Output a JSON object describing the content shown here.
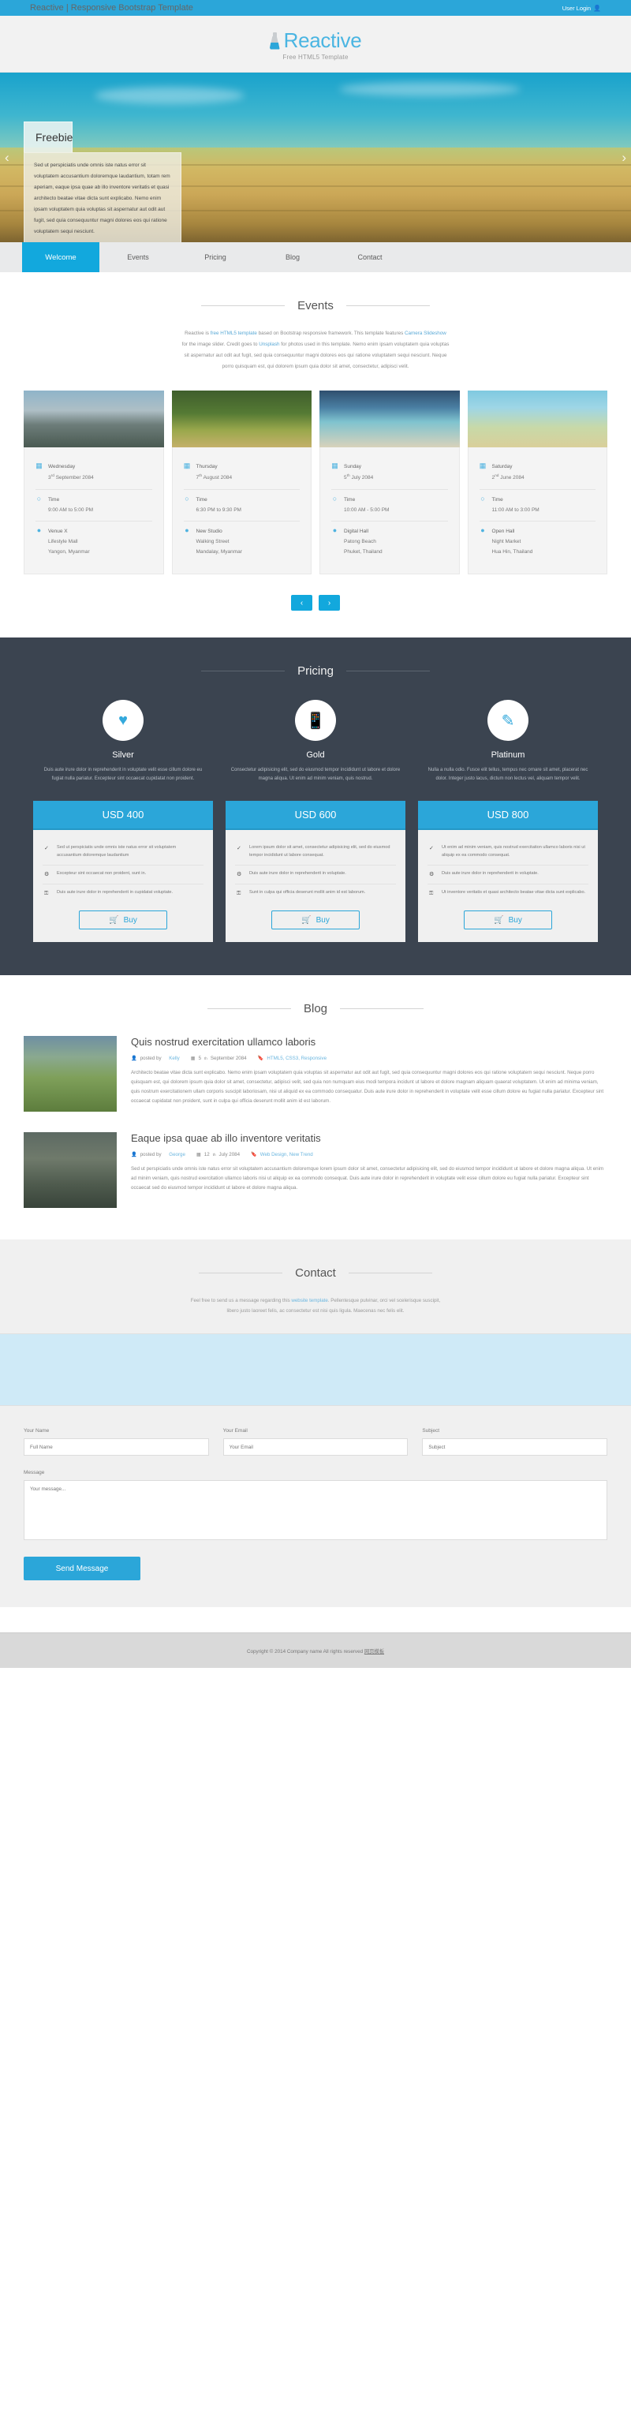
{
  "topbar": {
    "title": "Reactive | Responsive Bootstrap Template",
    "login_label": "User Login",
    "user_icon": "user-icon",
    "bg_color": "#2ba6d9"
  },
  "logo": {
    "name": "Reactive",
    "tagline": "Free HTML5 Template",
    "icon": "flask-icon",
    "accent_color": "#4ab5e2"
  },
  "hero": {
    "caption_title": "Freebie",
    "caption_body": "Sed ut perspiciatis unde omnis iste natus error sit voluptatem accusantium doloremque laudantium, totam rem aperiam, eaque ipsa quae ab illo inventore veritatis et quasi architecto beatae vitae dicta sunt explicabo. Nemo enim ipsam voluptatem quia voluptas sit aspernatur aut odit aut fugit, sed quia consequuntur magni dolores eos qui ratione voluptatem sequi nesciunt.",
    "prev_icon": "chevron-left-icon",
    "next_icon": "chevron-right-icon",
    "prev_glyph": "‹",
    "next_glyph": "›"
  },
  "nav": {
    "items": [
      {
        "label": "Welcome",
        "active": true
      },
      {
        "label": "Events",
        "active": false
      },
      {
        "label": "Pricing",
        "active": false
      },
      {
        "label": "Blog",
        "active": false
      },
      {
        "label": "Contact",
        "active": false
      }
    ],
    "active_color": "#12a8dd"
  },
  "events": {
    "heading": "Events",
    "intro_parts": [
      "Reactive is ",
      "free HTML5 template",
      " based on Bootstrap responsive framework. This template features ",
      "Camera Slideshow",
      " for the image slider. Credit goes to ",
      "Unsplash",
      " for photos used in this template. Nemo enim ipsam voluptatem quia voluptas sit aspernatur aut odit aut fugit, sed quia consequuntur magni dolores eos qui ratione voluptatem sequi nesciunt. Neque porro quisquam est, qui dolorem ipsum quia dolor sit amet, consectetur, adipisci velit."
    ],
    "cards": [
      {
        "image": "mountain-photo",
        "day": "Wednesday",
        "date": "3",
        "date_sup": "rd",
        "date_rest": " September 2084",
        "time_label": "Time",
        "time_value": "9:00 AM to 5:00 PM",
        "venue": "Venue X",
        "venue_line2": "Lifestyle Mall",
        "venue_line3": "Yangon, Myanmar"
      },
      {
        "image": "forest-path-photo",
        "day": "Thursday",
        "date": "7",
        "date_sup": "th",
        "date_rest": " August 2084",
        "time_label": "Time",
        "time_value": "6:30 PM to 9:30 PM",
        "venue": "New Studio",
        "venue_line2": "Walking Street",
        "venue_line3": "Mandalay, Myanmar"
      },
      {
        "image": "beach-photo",
        "day": "Sunday",
        "date": "5",
        "date_sup": "th",
        "date_rest": " July 2084",
        "time_label": "Time",
        "time_value": "10:00 AM - 5:00 PM",
        "venue": "Digital Hall",
        "venue_line2": "Patong Beach",
        "venue_line3": "Phuket, Thailand"
      },
      {
        "image": "van-palms-photo",
        "day": "Saturday",
        "date": "2",
        "date_sup": "nd",
        "date_rest": " June 2084",
        "time_label": "Time",
        "time_value": "11:00 AM to 3:00 PM",
        "venue": "Open Hall",
        "venue_line2": "Night Market",
        "venue_line3": "Hua Hin, Thailand"
      }
    ],
    "calendar_icon": "calendar-icon",
    "clock_icon": "clock-icon",
    "pin_icon": "map-pin-icon",
    "prev_glyph": "‹",
    "next_glyph": "›"
  },
  "pricing": {
    "heading": "Pricing",
    "bg_color": "#3b4450",
    "buy_label": "Buy",
    "cart_icon": "cart-icon",
    "plans": [
      {
        "icon": "heart-icon",
        "icon_glyph": "♥",
        "name": "Silver",
        "desc": "Duis aute irure dolor in reprehenderit in voluptate velit esse cillum dolore eu fugiat nulla pariatur. Excepteur sint occaecat cupidatat non proident.",
        "price": "USD 400",
        "features": [
          {
            "icon": "check-icon",
            "glyph": "✓",
            "text": "Sed ut perspiciatis unde omnis iste natus error sit voluptatem accusantium doloremque laudantium"
          },
          {
            "icon": "gear-icon",
            "glyph": "⚙",
            "text": "Excepteur sint occaecat non proident, sunt in."
          },
          {
            "icon": "lock-icon",
            "glyph": "⚿",
            "text": "Duis aute irure dolor in reprehenderit in cupidatat voluptate."
          }
        ]
      },
      {
        "icon": "mobile-icon",
        "icon_glyph": "☐",
        "name": "Gold",
        "desc": "Consectetur adipisicing elit, sed do eiusmod tempor incididunt ut labore et dolore magna aliqua. Ut enim ad minim veniam, quis nostrud.",
        "price": "USD 600",
        "features": [
          {
            "icon": "check-icon",
            "glyph": "✓",
            "text": "Lorem ipsum dolor sit amet, consectetur adipisicing elit, sed do eiusmod tempor incididunt ut labore consequat."
          },
          {
            "icon": "gear-icon",
            "glyph": "⚙",
            "text": "Duis aute irure dolor in reprehenderit in voluptate."
          },
          {
            "icon": "lock-icon",
            "glyph": "⚿",
            "text": "Sunt in culpa qui officia deserunt mollit anim id est laborum."
          }
        ]
      },
      {
        "icon": "pencil-icon",
        "icon_glyph": "✎",
        "name": "Platinum",
        "desc": "Nulla a nulla odio. Fusce elit tellus, tempus nec ornare sit amet, placerat nec dolor. Integer justo lacus, dictum non lectus vel, aliquam tempor velit.",
        "price": "USD 800",
        "features": [
          {
            "icon": "check-icon",
            "glyph": "✓",
            "text": "Ut enim ad minim veniam, quis nostrud exercitation ullamco laboris nisi ut aliquip ex ea commodo consequat."
          },
          {
            "icon": "gear-icon",
            "glyph": "⚙",
            "text": "Duis aute irure dolor in reprehenderit in voluptate."
          },
          {
            "icon": "lock-icon",
            "glyph": "⚿",
            "text": "Ut inventore veritatis et quasi architecto beatae vitae dicta sunt explicabo."
          }
        ]
      }
    ]
  },
  "blog": {
    "heading": "Blog",
    "posts": [
      {
        "thumb": "mountain-trail-photo",
        "title": "Quis nostrud exercitation ullamco laboris",
        "author_prefix": "posted by",
        "author": "Kelly",
        "date": "5",
        "date_sup": "th",
        "date_rest": " September 2084",
        "tags": "HTML5, CSS3, Responsive",
        "user_icon": "user-icon",
        "calendar_icon": "calendar-icon",
        "tag_icon": "bookmark-icon",
        "body": "Architecto beatae vitae dicta sunt explicabo. Nemo enim ipsam voluptatem quia voluptas sit aspernatur aut odit aut fugit, sed quia consequuntur magni dolores eos qui ratione voluptatem sequi nesciunt. Neque porro quisquam est, qui dolorem ipsum quia dolor sit amet, consectetur, adipisci velit, sed quia non numquam eius modi tempora incidunt ut labore et dolore magnam aliquam quaerat voluptatem. Ut enim ad minima veniam, quis nostrum exercitationem ullam corporis suscipit laboriosam, nisi ut aliquid ex ea commodo consequatur. Duis aute irure dolor in reprehenderit in voluptate velit esse cillum dolore eu fugiat nulla pariatur. Excepteur sint occaecat cupidatat non proident, sunt in culpa qui officia deserunt mollit anim id est laborum."
      },
      {
        "thumb": "rocks-photo",
        "title": "Eaque ipsa quae ab illo inventore veritatis",
        "author_prefix": "posted by",
        "author": "George",
        "date": "12",
        "date_sup": "th",
        "date_rest": " July 2084",
        "tags": "Web Design, New Trend",
        "user_icon": "user-icon",
        "calendar_icon": "calendar-icon",
        "tag_icon": "bookmark-icon",
        "body": "Sed ut perspiciatis unde omnis iste natus error sit voluptatem accusantium doloremque lorem ipsum dolor sit amet, consectetur adipisicing elit, sed do eiusmod tempor incididunt ut labore et dolore magna aliqua. Ut enim ad minim veniam, quis nostrud exercitation ullamco laboris nisi ut aliquip ex ea commodo consequat. Duis aute irure dolor in reprehenderit in voluptate velit esse cillum dolore eu fugiat nulla pariatur. Excepteur sint occaecat sed do eiusmod tempor incididunt ut labore et dolore magna aliqua."
      }
    ]
  },
  "contact": {
    "heading": "Contact",
    "intro_parts": [
      "Feel free to send us a message regarding this ",
      "website template",
      ". Pellentesque pulvinar, orci vel scelerisque suscipit, libero justo laoreet felis, ac consectetur est nisi quis ligula. Maecenas nec felis elit."
    ],
    "map_alt": "map-area",
    "fields": [
      {
        "label": "Your Name",
        "placeholder": "Full Name",
        "value": ""
      },
      {
        "label": "Your Email",
        "placeholder": "Your Email",
        "value": ""
      },
      {
        "label": "Subject",
        "placeholder": "Subject",
        "value": ""
      }
    ],
    "message_label": "Message",
    "message_placeholder": "Your message...",
    "message_value": "",
    "send_label": "Send Message"
  },
  "footer": {
    "text": "Copyright © 2014 Company name All rights reserved ",
    "link": "网页模板"
  }
}
